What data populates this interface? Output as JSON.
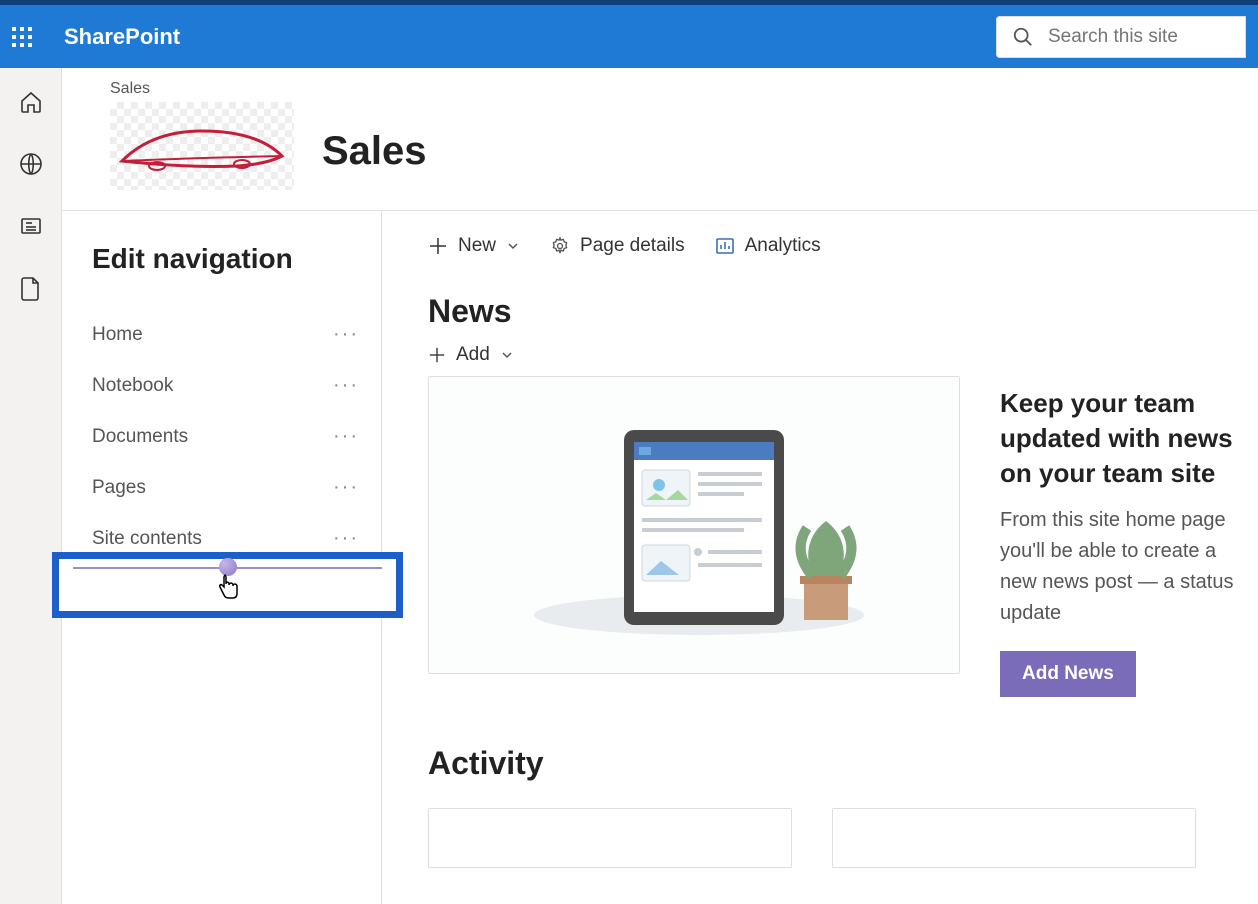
{
  "header": {
    "brand": "SharePoint",
    "search_placeholder": "Search this site"
  },
  "site": {
    "breadcrumb": "Sales",
    "title": "Sales"
  },
  "nav": {
    "title": "Edit navigation",
    "items": [
      {
        "label": "Home"
      },
      {
        "label": "Notebook"
      },
      {
        "label": "Documents"
      },
      {
        "label": "Pages"
      },
      {
        "label": "Site contents"
      }
    ]
  },
  "cmdbar": {
    "new_label": "New",
    "pagedetails_label": "Page details",
    "analytics_label": "Analytics"
  },
  "news": {
    "section": "News",
    "add_label": "Add",
    "heading": "Keep your team updated with news on your team site",
    "description": "From this site home page you'll be able to create a new news post — a status update",
    "button": "Add News"
  },
  "activity": {
    "section": "Activity"
  },
  "colors": {
    "header_bg": "#1e7ad4",
    "primary_btn": "#7a6cb8",
    "highlight_border": "#1e5ec8"
  }
}
